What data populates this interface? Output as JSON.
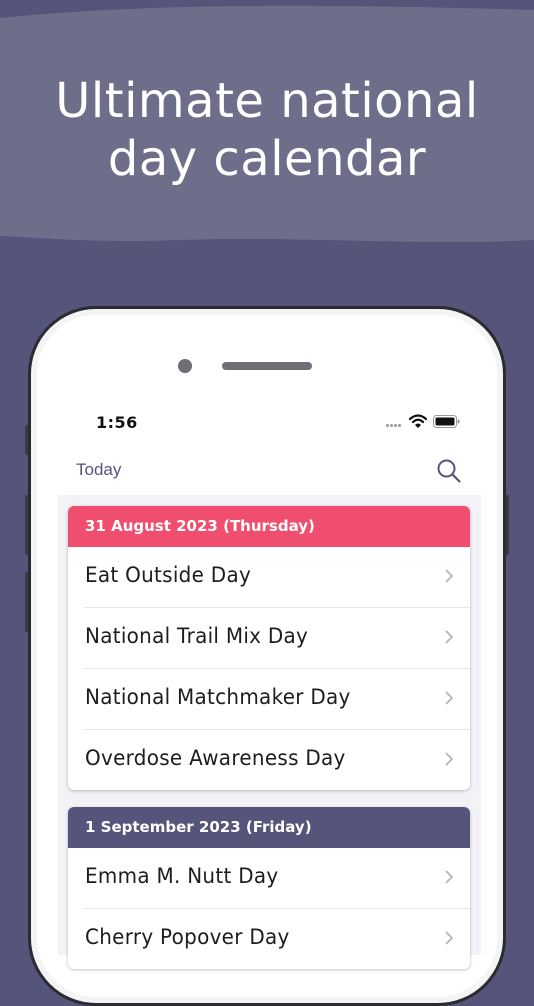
{
  "hero": {
    "title_line1": "Ultimate national",
    "title_line2": "day calendar"
  },
  "colors": {
    "background": "#55547a",
    "hero_band": "#6e6e8a",
    "header_red": "#f04e6e",
    "header_purple": "#55547a"
  },
  "status_bar": {
    "time": "1:56",
    "icons": [
      "signal-dots-icon",
      "wifi-icon",
      "battery-icon"
    ]
  },
  "nav": {
    "today_label": "Today",
    "search_icon": "search-icon"
  },
  "sections": [
    {
      "date_label": "31 August 2023 (Thursday)",
      "items": [
        "Eat Outside Day",
        "National Trail Mix Day",
        "National Matchmaker Day",
        "Overdose Awareness Day"
      ]
    },
    {
      "date_label": "1 September 2023 (Friday)",
      "items": [
        "Emma M. Nutt Day",
        "Cherry Popover Day"
      ]
    }
  ]
}
